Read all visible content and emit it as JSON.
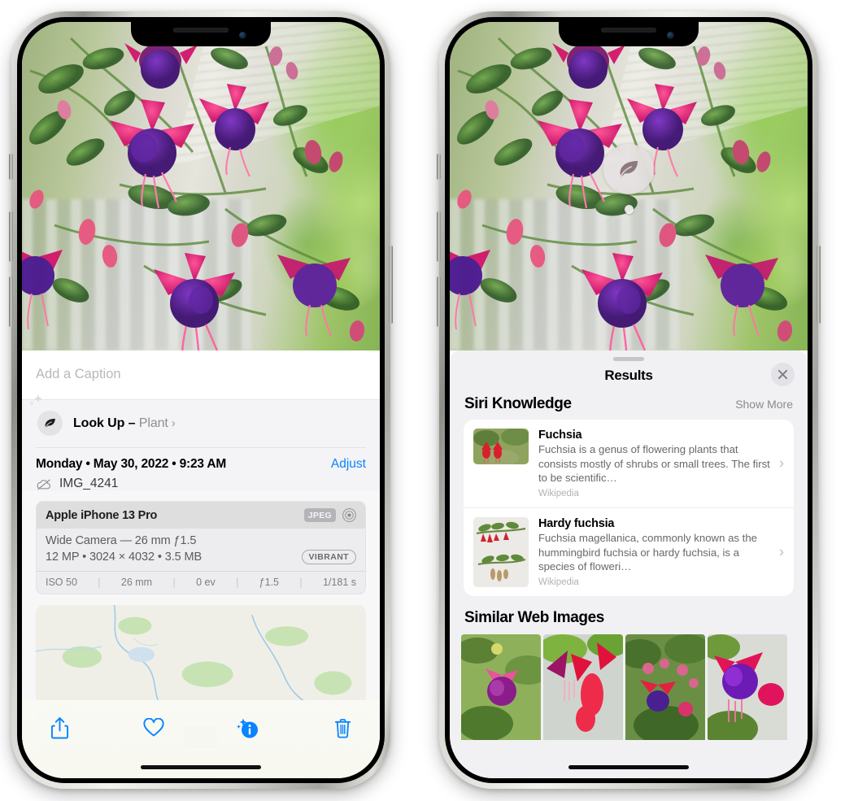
{
  "left_phone": {
    "photo_alt": "fuchsia-flowers-photo",
    "caption_placeholder": "Add a Caption",
    "lookup": {
      "icon": "leaf-icon",
      "sparkle_icon": "sparkles-icon",
      "label": "Look Up – ",
      "subject": "Plant",
      "chevron": "›"
    },
    "metadata": {
      "date_line": "Monday • May 30, 2022 • 9:23 AM",
      "adjust_label": "Adjust",
      "cloud_icon": "icloud-slash-icon",
      "filename": "IMG_4241"
    },
    "camera_card": {
      "model": "Apple iPhone 13 Pro",
      "format_badge": "JPEG",
      "lens_icon": "aperture-icon",
      "lens_line": "Wide Camera — 26 mm ƒ1.5",
      "size_line": "12 MP • 3024 × 4032 • 3.5 MB",
      "style_badge": "VIBRANT",
      "exif": [
        "ISO 50",
        "26 mm",
        "0 ev",
        "ƒ1.5",
        "1/181 s"
      ]
    },
    "map": {
      "alt": "location-map-preview",
      "pin_alt": "photo-location-pin"
    },
    "toolbar": [
      {
        "name": "share-button",
        "icon": "share-icon"
      },
      {
        "name": "favorite-button",
        "icon": "heart-icon"
      },
      {
        "name": "info-button",
        "icon": "info-sparkle-icon"
      },
      {
        "name": "delete-button",
        "icon": "trash-icon"
      }
    ]
  },
  "right_phone": {
    "photo_alt": "fuchsia-flowers-photo",
    "visual_lookup_marker": {
      "icon": "leaf-icon",
      "alt": "visual-look-up-leaf-badge"
    },
    "sheet": {
      "grabber": "drag-handle",
      "title": "Results",
      "close_icon": "close-icon"
    },
    "siri_knowledge": {
      "title": "Siri Knowledge",
      "show_more": "Show More",
      "items": [
        {
          "thumb_alt": "fuchsia-thumbnail",
          "title": "Fuchsia",
          "description": "Fuchsia is a genus of flowering plants that consists mostly of shrubs or small trees. The first to be scientific…",
          "source": "Wikipedia",
          "chevron": "›"
        },
        {
          "thumb_alt": "hardy-fuchsia-thumbnail",
          "title": "Hardy fuchsia",
          "description": "Fuchsia magellanica, commonly known as the hummingbird fuchsia or hardy fuchsia, is a species of floweri…",
          "source": "Wikipedia",
          "chevron": "›"
        }
      ]
    },
    "similar_web_images": {
      "title": "Similar Web Images",
      "items": [
        {
          "alt": "similar-image-1"
        },
        {
          "alt": "similar-image-2"
        },
        {
          "alt": "similar-image-3"
        },
        {
          "alt": "similar-image-4"
        }
      ]
    }
  },
  "colors": {
    "accent_blue": "#0a84ff",
    "sheet_bg": "#f1f1f4",
    "card_bg": "#ffffff",
    "secondary_text": "#8e8e93"
  }
}
